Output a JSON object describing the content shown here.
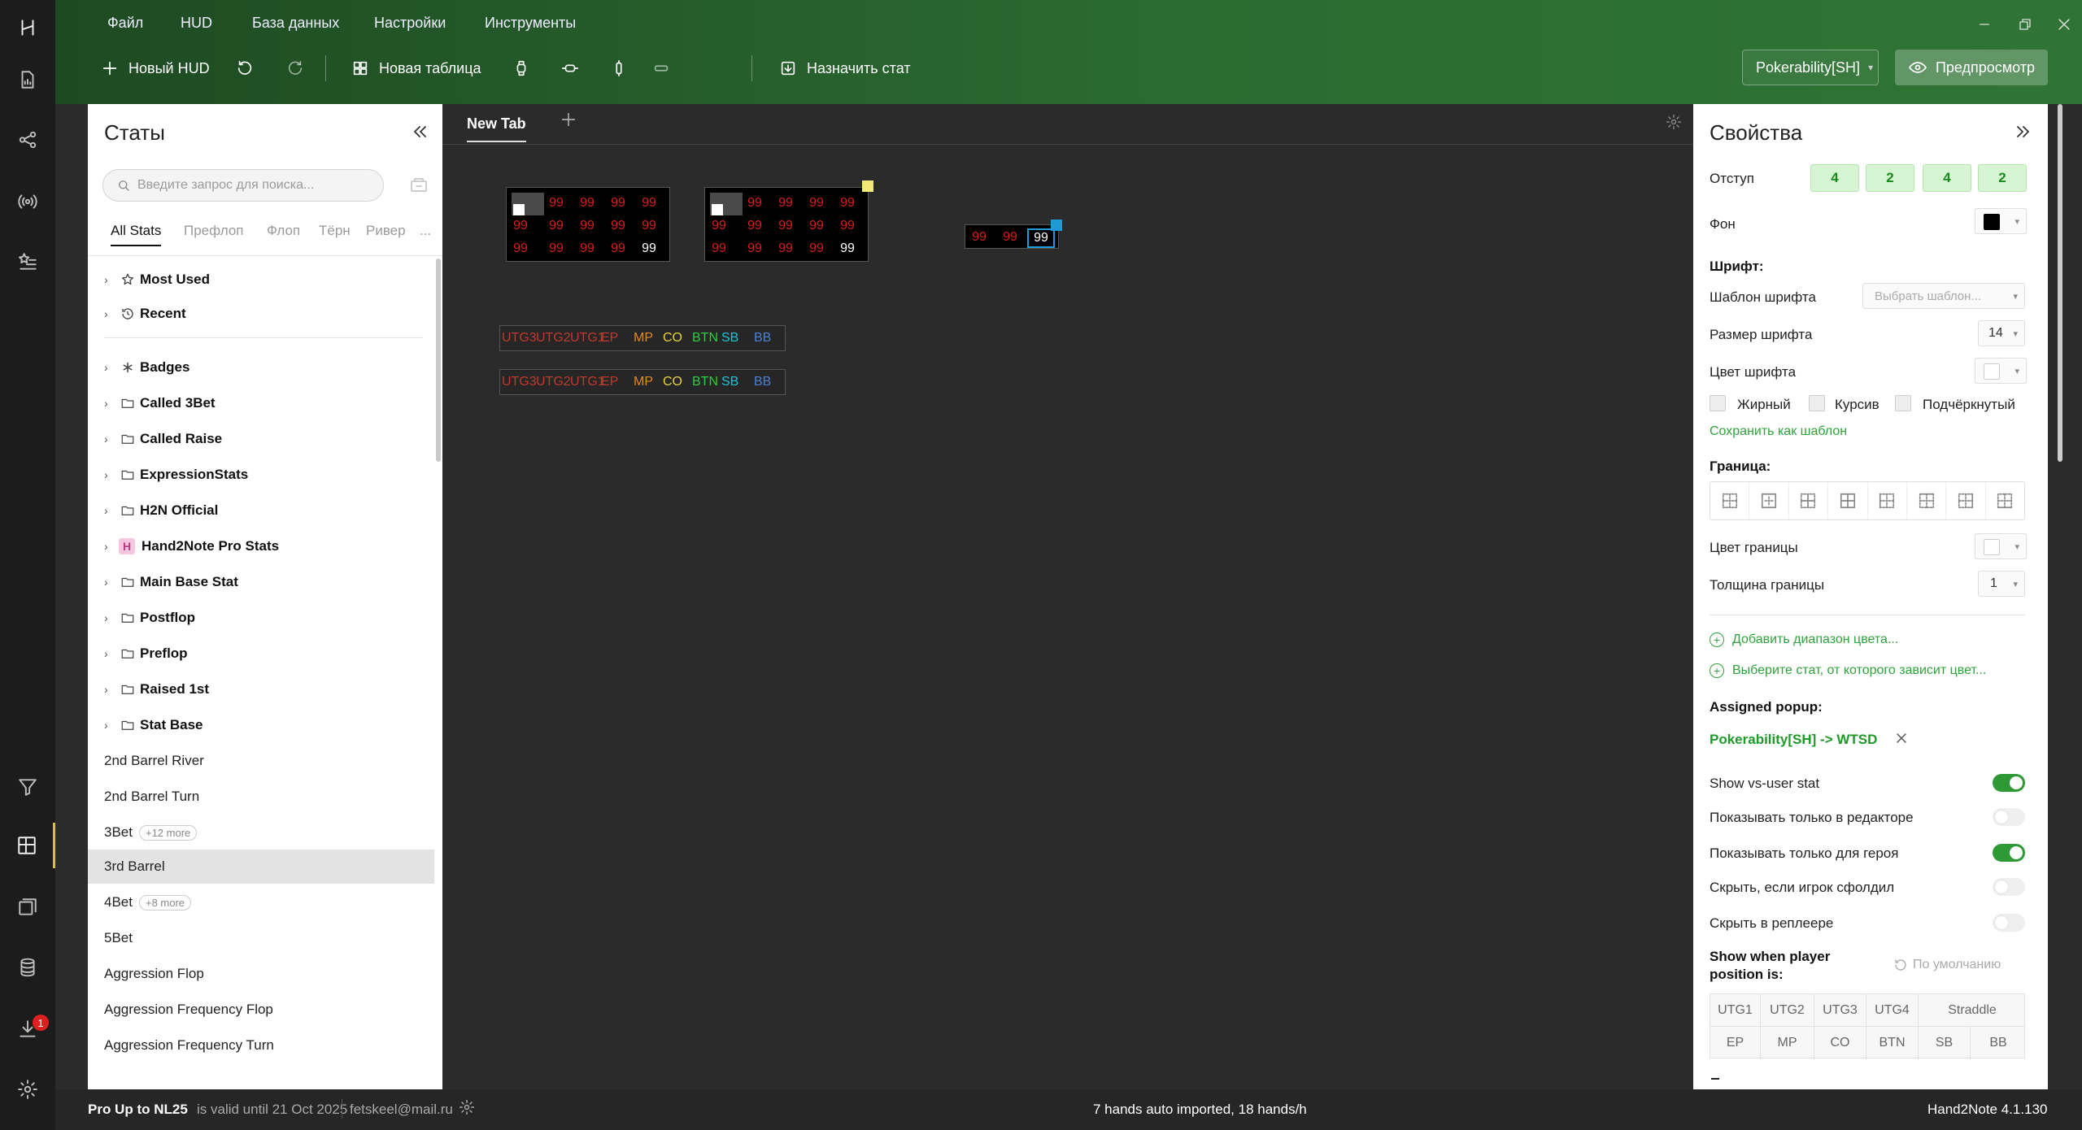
{
  "menu": [
    "Файл",
    "HUD",
    "База данных",
    "Настройки",
    "Инструменты"
  ],
  "toolbar": {
    "new_hud": "Новый HUD",
    "new_table": "Новая таблица",
    "assign_stat": "Назначить стат",
    "hud_select": "Pokerability[SH]",
    "preview": "Предпросмотр"
  },
  "stats_panel": {
    "title": "Статы",
    "search_placeholder": "Введите запрос для поиска...",
    "tabs": [
      "All Stats",
      "Префлоп",
      "Флоп",
      "Тёрн",
      "Ривер",
      "..."
    ],
    "folders_top": [
      "Most Used",
      "Recent"
    ],
    "folders": [
      "Badges",
      "Called 3Bet",
      "Called Raise",
      "ExpressionStats",
      "H2N Official",
      "Hand2Note Pro Stats",
      "Main Base Stat",
      "Postflop",
      "Preflop",
      "Raised 1st",
      "Stat Base"
    ],
    "stats": [
      {
        "name": "2nd Barrel River",
        "more": ""
      },
      {
        "name": "2nd Barrel Turn",
        "more": ""
      },
      {
        "name": "3Bet",
        "more": "+12 more"
      },
      {
        "name": "3rd Barrel",
        "more": ""
      },
      {
        "name": "4Bet",
        "more": "+8 more"
      },
      {
        "name": "5Bet",
        "more": ""
      },
      {
        "name": "Aggression Flop",
        "more": ""
      },
      {
        "name": "Aggression Frequency Flop",
        "more": ""
      },
      {
        "name": "Aggression Frequency Turn",
        "more": ""
      }
    ]
  },
  "editor": {
    "tab": "New Tab",
    "cell_value": "99",
    "positions": [
      "UTG3",
      "UTG2",
      "UTG1",
      "EP",
      "MP",
      "CO",
      "BTN",
      "SB",
      "BB"
    ],
    "position_colors": {
      "red": "#c0392b",
      "orange": "#e08a1e",
      "yellow": "#e6d23a",
      "green": "#2ecc40",
      "cyan": "#19c6d6",
      "blue": "#4a7fd4"
    },
    "marker_colors": {
      "yellow": "#f2e97a",
      "blue": "#1e9bd7"
    }
  },
  "props": {
    "title": "Свойства",
    "indent_label": "Отступ",
    "indent_values": [
      "4",
      "2",
      "4",
      "2"
    ],
    "bg_label": "Фон",
    "font_section": "Шрифт:",
    "font_template_label": "Шаблон шрифта",
    "font_template_placeholder": "Выбрать шаблон...",
    "font_size_label": "Размер шрифта",
    "font_size": "14",
    "font_color_label": "Цвет шрифта",
    "bold": "Жирный",
    "italic": "Курсив",
    "underline": "Подчёркнутый",
    "save_template": "Сохранить как шаблон",
    "border_section": "Граница:",
    "border_color_label": "Цвет границы",
    "border_width_label": "Толщина границы",
    "border_width": "1",
    "add_color_range": "Добавить диапазон цвета...",
    "select_stat_color": "Выберите стат, от которого зависит цвет...",
    "assigned_popup_label": "Assigned popup:",
    "assigned_popup": "Pokerability[SH] -> WTSD",
    "toggles": [
      {
        "label": "Show vs-user stat",
        "on": true
      },
      {
        "label": "Показывать только в редакторе",
        "on": false
      },
      {
        "label": "Показывать только для героя",
        "on": true
      },
      {
        "label": "Скрыть, если игрок сфолдил",
        "on": false
      },
      {
        "label": "Скрыть в реплеере",
        "on": false
      }
    ],
    "show_when_label": "Show when player position is:",
    "default_label": "По умолчанию",
    "positions_row1": [
      "UTG1",
      "UTG2",
      "UTG3",
      "UTG4",
      "Straddle"
    ],
    "positions_row2": [
      "EP",
      "MP",
      "CO",
      "BTN",
      "SB",
      "BB"
    ]
  },
  "status": {
    "license": "Pro Up to NL25",
    "valid_until": "is valid until 21 Oct 2025",
    "email": "fetskeel@mail.ru",
    "import": "7 hands auto imported, 18 hands/h",
    "version": "Hand2Note 4.1.130"
  },
  "rail": {
    "download_badge": "1"
  }
}
